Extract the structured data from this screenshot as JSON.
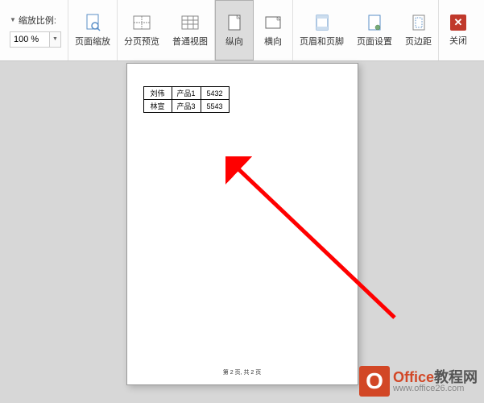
{
  "ribbon": {
    "zoom_section": {
      "label": "缩放比例:",
      "value": "100 %",
      "page_zoom_label": "页面缩放"
    },
    "buttons": {
      "page_break_preview": "分页预览",
      "normal_view": "普通视图",
      "portrait": "纵向",
      "landscape": "横向",
      "header_footer": "页眉和页脚",
      "page_setup": "页面设置",
      "margins": "页边距",
      "close": "关闭"
    }
  },
  "document": {
    "table": {
      "rows": [
        [
          "刘伟",
          "产品1",
          "5432"
        ],
        [
          "林宣",
          "产品3",
          "5543"
        ]
      ]
    },
    "page_footer": "第 2 页, 共 2 页"
  },
  "watermark": {
    "logo_letter": "O",
    "title_main": "Office",
    "title_suffix": "教程网",
    "url": "www.office26.com"
  }
}
